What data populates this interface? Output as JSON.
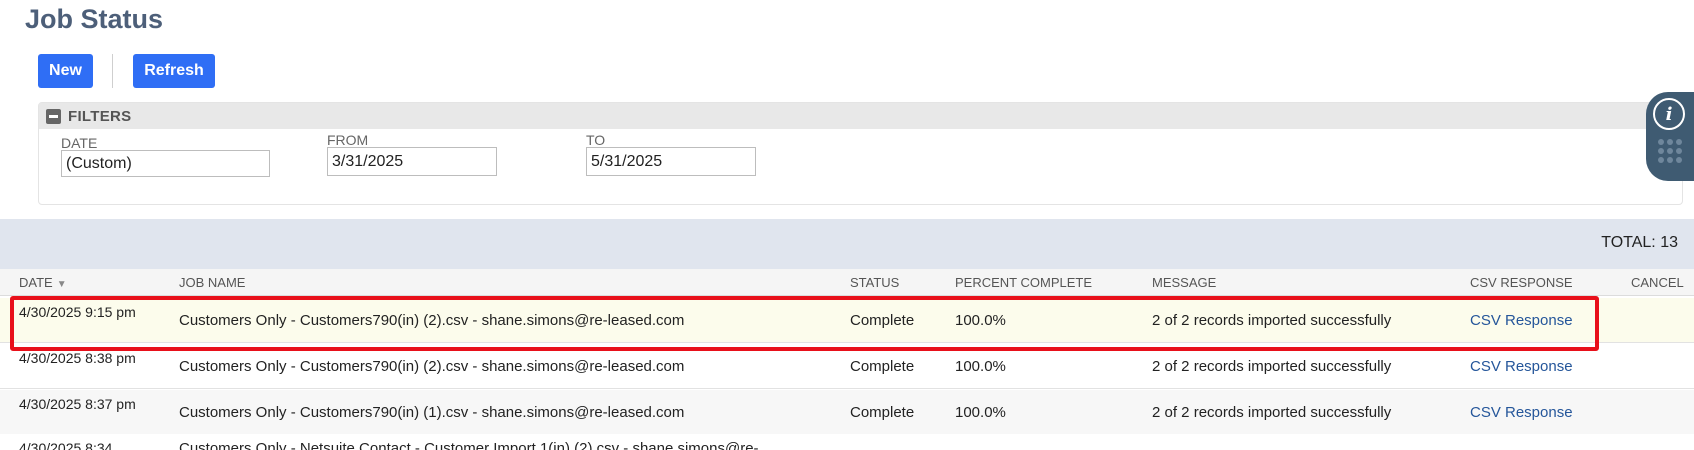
{
  "page": {
    "title": "Job Status"
  },
  "toolbar": {
    "new_label": "New",
    "refresh_label": "Refresh"
  },
  "filters": {
    "title": "FILTERS",
    "date": {
      "label": "DATE",
      "value": "(Custom)"
    },
    "from": {
      "label": "FROM",
      "value": "3/31/2025"
    },
    "to": {
      "label": "TO",
      "value": "5/31/2025"
    }
  },
  "side_widget": {
    "info_glyph": "i",
    "icons": [
      "info-icon",
      "grid-dots-icon"
    ]
  },
  "total": {
    "label": "TOTAL: 13"
  },
  "table": {
    "columns": {
      "date": "DATE",
      "job_name": "JOB NAME",
      "status": "STATUS",
      "percent": "PERCENT COMPLETE",
      "message": "MESSAGE",
      "csv": "CSV RESPONSE",
      "cancel": "CANCEL"
    },
    "sort_indicator": "▼",
    "rows": [
      {
        "date": "4/30/2025 9:15 pm",
        "job_name": "Customers Only - Customers790(in) (2).csv - shane.simons@re-leased.com",
        "status": "Complete",
        "percent": "100.0%",
        "message": "2 of 2 records imported successfully",
        "csv": "CSV Response"
      },
      {
        "date": "4/30/2025 8:38 pm",
        "job_name": "Customers Only - Customers790(in) (2).csv - shane.simons@re-leased.com",
        "status": "Complete",
        "percent": "100.0%",
        "message": "2 of 2 records imported successfully",
        "csv": "CSV Response"
      },
      {
        "date": "4/30/2025 8:37 pm",
        "job_name": "Customers Only - Customers790(in) (1).csv - shane.simons@re-leased.com",
        "status": "Complete",
        "percent": "100.0%",
        "message": "2 of 2 records imported successfully",
        "csv": "CSV Response"
      },
      {
        "date": "4/30/2025 8:34",
        "job_name": "Customers Only - Netsuite Contact - Customer Import 1(in) (2).csv - shane.simons@re-"
      }
    ]
  },
  "colors": {
    "accent": "#2f6ef5",
    "title": "#4d5f79",
    "link": "#25569a",
    "highlight_border": "#e8101a",
    "total_bar": "#e0e5ee"
  }
}
